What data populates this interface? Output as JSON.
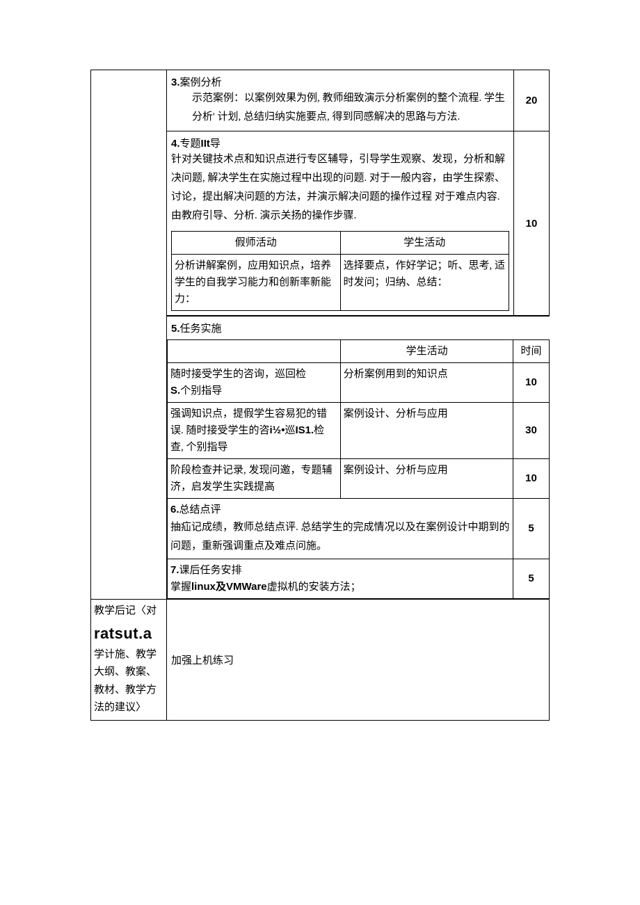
{
  "row3": {
    "num": "3.",
    "title": "案例分析",
    "body": "示范案例：以案例效果为例, 教师细致演示分析案例的整个流程. 学生分析' 计划, 总结归纳实施要点, 得到同感解决的思路与方法.",
    "time": "20"
  },
  "row4": {
    "num": "4.",
    "title": "专题IIt导",
    "body": "针对关键技术点和知识点进行专区辅导，引导学生观察、发现，分析和解决问题, 解决学生在实施过程中出现的问题. 对于一般内容，由学生探索、讨论，提出解决问题的方法，并演示解决问题的操作过程  对于难点内容. 由教府引导、分析. 演示关扬的操作步骤.",
    "time": "10",
    "inner": {
      "h1": "假师活动",
      "h2": "学生活动",
      "c1": "分析讲解案例，应用知识点，培养学生的自我学习能力和创新率新能力：",
      "c2": "选择要点，作好学记；听、思考, 适时发问；归纳、总结："
    }
  },
  "row5": {
    "num": "5.",
    "title": "任务实施",
    "h2": "学生活动",
    "h3": "时间",
    "r1": {
      "c1a": "随时接受学生的咨询，巡回检",
      "c1b_num": "S.",
      "c1b_txt": "个别指导",
      "c2": "分析案例用到的知识点",
      "c3": "10"
    },
    "r2": {
      "c1": "强调知识点，提假学生容易犯的错误. 随时接受学生的咨i½•巡IS1.检查, 个别指导",
      "c2": "案例设计、分析与应用",
      "c3": "30"
    },
    "r3": {
      "c1": "阶段检查并记录, 发现问邀，专题辅济，启发学生实践提高",
      "c2": "案例设计、分析与应用",
      "c3": "10"
    }
  },
  "row6": {
    "num": "6.",
    "title": "总结点评",
    "body": "抽疝记成绩，教师总结点评. 总结学生的完成情况以及在案例设计中期到的问题，重新强调重点及难点问施。",
    "time": "5"
  },
  "row7": {
    "num": "7.",
    "title": "课后任务安排",
    "body_pre": "掌握",
    "body_bold": "linux及VMWare",
    "body_post": "虚拟机的安装方法；",
    "time": "5"
  },
  "footer": {
    "left_l1": "教学后记〈对",
    "left_l2": "ratsut.a",
    "left_l3": "学计施、教学大纲、教案、教材、教学方法的建议〉",
    "right": "加强上机练习"
  }
}
